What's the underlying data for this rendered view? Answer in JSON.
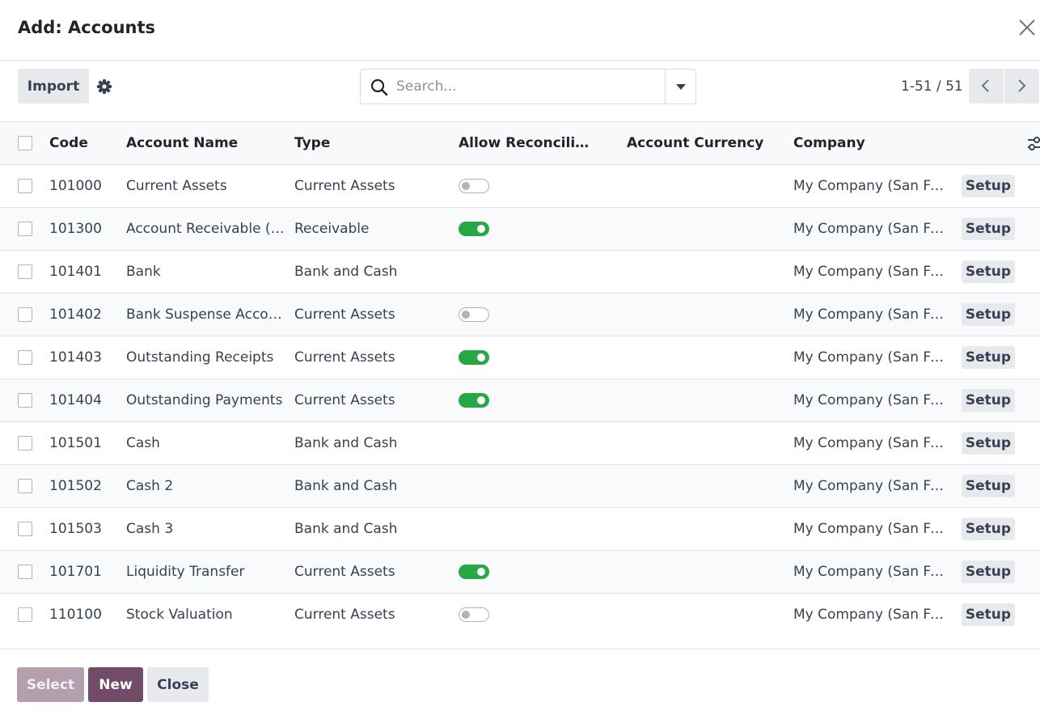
{
  "dialog": {
    "title": "Add: Accounts"
  },
  "control": {
    "import_label": "Import",
    "search_placeholder": "Search...",
    "pager": "1-51 / 51"
  },
  "table": {
    "columns": {
      "code": "Code",
      "name": "Account Name",
      "type": "Type",
      "reconcile": "Allow Reconcili…",
      "currency": "Account Currency",
      "company": "Company"
    },
    "rows": [
      {
        "code": "101000",
        "name": "Current Assets",
        "type": "Current Assets",
        "reconcile": "off",
        "currency": "",
        "company": "My Company (San Francisco)",
        "action": "Setup"
      },
      {
        "code": "101300",
        "name": "Account Receivable (PoS)",
        "type": "Receivable",
        "reconcile": "on",
        "currency": "",
        "company": "My Company (San Francisco)",
        "action": "Setup"
      },
      {
        "code": "101401",
        "name": "Bank",
        "type": "Bank and Cash",
        "reconcile": "none",
        "currency": "",
        "company": "My Company (San Francisco)",
        "action": "Setup"
      },
      {
        "code": "101402",
        "name": "Bank Suspense Account",
        "type": "Current Assets",
        "reconcile": "off",
        "currency": "",
        "company": "My Company (San Francisco)",
        "action": "Setup"
      },
      {
        "code": "101403",
        "name": "Outstanding Receipts",
        "type": "Current Assets",
        "reconcile": "on",
        "currency": "",
        "company": "My Company (San Francisco)",
        "action": "Setup"
      },
      {
        "code": "101404",
        "name": "Outstanding Payments",
        "type": "Current Assets",
        "reconcile": "on",
        "currency": "",
        "company": "My Company (San Francisco)",
        "action": "Setup"
      },
      {
        "code": "101501",
        "name": "Cash",
        "type": "Bank and Cash",
        "reconcile": "none",
        "currency": "",
        "company": "My Company (San Francisco)",
        "action": "Setup"
      },
      {
        "code": "101502",
        "name": "Cash 2",
        "type": "Bank and Cash",
        "reconcile": "none",
        "currency": "",
        "company": "My Company (San Francisco)",
        "action": "Setup"
      },
      {
        "code": "101503",
        "name": "Cash 3",
        "type": "Bank and Cash",
        "reconcile": "none",
        "currency": "",
        "company": "My Company (San Francisco)",
        "action": "Setup"
      },
      {
        "code": "101701",
        "name": "Liquidity Transfer",
        "type": "Current Assets",
        "reconcile": "on",
        "currency": "",
        "company": "My Company (San Francisco)",
        "action": "Setup"
      },
      {
        "code": "110100",
        "name": "Stock Valuation",
        "type": "Current Assets",
        "reconcile": "off",
        "currency": "",
        "company": "My Company (San Francisco)",
        "action": "Setup"
      }
    ]
  },
  "footer": {
    "select_label": "Select",
    "new_label": "New",
    "close_label": "Close"
  },
  "colors": {
    "primary": "#714b67",
    "primary_disabled": "#b49fae",
    "toggle_on": "#28a745",
    "secondary_button": "#e7e9ed"
  },
  "icons": {
    "close": "close-icon",
    "settings": "gear-icon",
    "search": "search-icon",
    "search_options": "caret-down-icon",
    "pager_prev": "chevron-left-icon",
    "pager_next": "chevron-right-icon",
    "optional_columns": "sliders-icon"
  }
}
